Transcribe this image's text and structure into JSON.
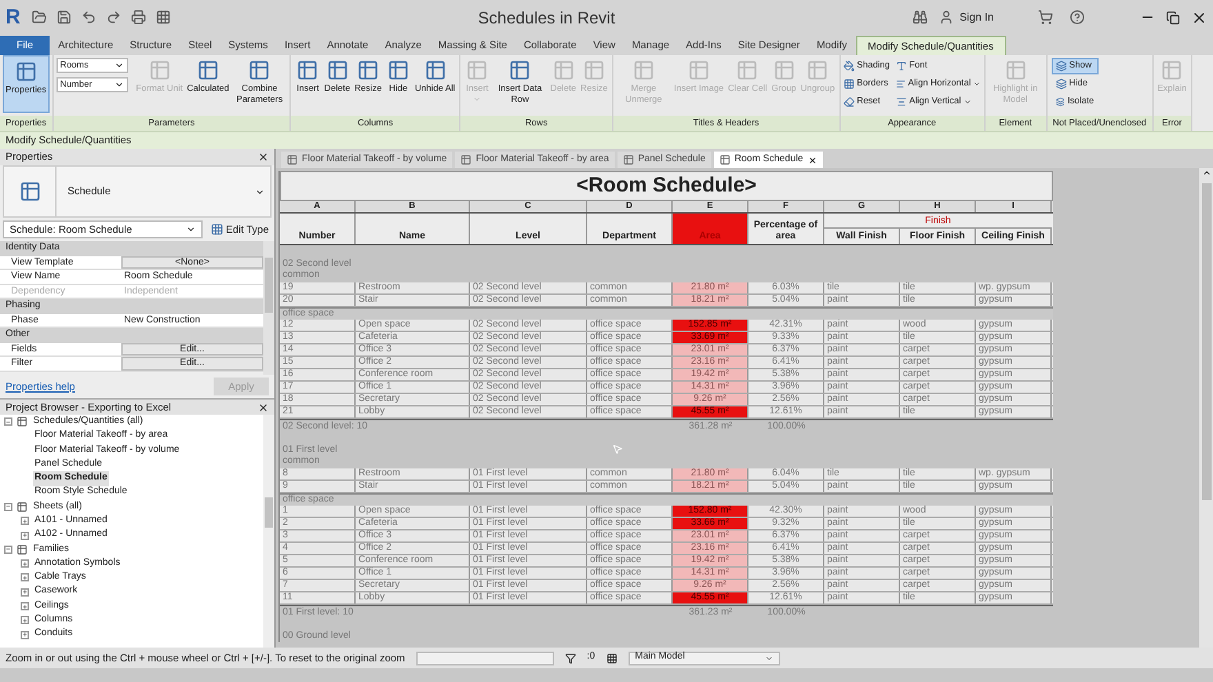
{
  "app_logo": "R",
  "window": {
    "title": "Schedules in Revit",
    "sign_in": "Sign In"
  },
  "ribbon_tabs": [
    {
      "label": "File",
      "kind": "file",
      "selected": false
    },
    {
      "label": "Architecture",
      "kind": "tab",
      "selected": false
    },
    {
      "label": "Structure",
      "kind": "tab",
      "selected": false
    },
    {
      "label": "Steel",
      "kind": "tab",
      "selected": false
    },
    {
      "label": "Systems",
      "kind": "tab",
      "selected": false
    },
    {
      "label": "Insert",
      "kind": "tab",
      "selected": false
    },
    {
      "label": "Annotate",
      "kind": "tab",
      "selected": false
    },
    {
      "label": "Analyze",
      "kind": "tab",
      "selected": false
    },
    {
      "label": "Massing & Site",
      "kind": "tab",
      "selected": false
    },
    {
      "label": "Collaborate",
      "kind": "tab",
      "selected": false
    },
    {
      "label": "View",
      "kind": "tab",
      "selected": false
    },
    {
      "label": "Manage",
      "kind": "tab",
      "selected": false
    },
    {
      "label": "Add-Ins",
      "kind": "tab",
      "selected": false
    },
    {
      "label": "Site Designer",
      "kind": "tab",
      "selected": false
    },
    {
      "label": "Modify",
      "kind": "tab",
      "selected": false
    },
    {
      "label": "Modify Schedule/Quantities",
      "kind": "tab",
      "selected": true
    }
  ],
  "ribbon_panels": [
    {
      "label": "Properties",
      "items": [
        {
          "kind": "large",
          "label": "Properties",
          "disabled": false,
          "active": true
        }
      ]
    },
    {
      "label": "Parameters",
      "items": [
        {
          "kind": "dropdowns",
          "values": [
            "Rooms",
            "Number"
          ]
        },
        {
          "kind": "large",
          "label": "Format Unit",
          "disabled": true
        },
        {
          "kind": "large",
          "label": "Calculated",
          "disabled": false
        },
        {
          "kind": "large",
          "label": "Combine Parameters",
          "disabled": false
        }
      ]
    },
    {
      "label": "Columns",
      "items": [
        {
          "kind": "large",
          "label": "Insert",
          "disabled": false
        },
        {
          "kind": "large",
          "label": "Delete",
          "disabled": false
        },
        {
          "kind": "large",
          "label": "Resize",
          "disabled": false
        },
        {
          "kind": "large",
          "label": "Hide",
          "disabled": false
        },
        {
          "kind": "large",
          "label": "Unhide All",
          "disabled": false
        }
      ]
    },
    {
      "label": "Rows",
      "items": [
        {
          "kind": "large",
          "label": "Insert",
          "disabled": true,
          "dropdown": true
        },
        {
          "kind": "large",
          "label": "Insert Data Row",
          "disabled": false
        },
        {
          "kind": "large",
          "label": "Delete",
          "disabled": true
        },
        {
          "kind": "large",
          "label": "Resize",
          "disabled": true
        }
      ]
    },
    {
      "label": "Titles & Headers",
      "items": [
        {
          "kind": "large",
          "label": "Merge Unmerge",
          "disabled": true
        },
        {
          "kind": "large",
          "label": "Insert Image",
          "disabled": true
        },
        {
          "kind": "large",
          "label": "Clear Cell",
          "disabled": true
        },
        {
          "kind": "large",
          "label": "Group",
          "disabled": true
        },
        {
          "kind": "large",
          "label": "Ungroup",
          "disabled": true
        }
      ]
    },
    {
      "label": "Appearance",
      "items": [
        {
          "kind": "smallgrid",
          "buttons": [
            {
              "label": "Shading",
              "dropdown": false
            },
            {
              "label": "Font",
              "dropdown": false
            },
            {
              "label": "Borders",
              "dropdown": false
            },
            {
              "label": "Align Horizontal",
              "dropdown": true
            },
            {
              "label": "Reset",
              "dropdown": false
            },
            {
              "label": "Align Vertical",
              "dropdown": true
            }
          ]
        }
      ]
    },
    {
      "label": "Element",
      "items": [
        {
          "kind": "large",
          "label": "Highlight in Model",
          "disabled": true
        }
      ]
    },
    {
      "label": "Not Placed/Unenclosed",
      "items": [
        {
          "kind": "smallstack",
          "buttons": [
            {
              "label": "Show",
              "selected": true
            },
            {
              "label": "Hide",
              "selected": false
            },
            {
              "label": "Isolate",
              "selected": false
            }
          ]
        }
      ]
    },
    {
      "label": "Error",
      "items": [
        {
          "kind": "large",
          "label": "Explain",
          "disabled": true
        }
      ]
    }
  ],
  "context_bar": "Modify Schedule/Quantities",
  "properties": {
    "title": "Properties",
    "type_name": "Schedule",
    "selector": "Schedule: Room Schedule",
    "edit_type": "Edit Type",
    "rows": [
      {
        "kind": "category",
        "label": "Identity Data"
      },
      {
        "kind": "button",
        "label": "View Template",
        "value": "<None>",
        "disabled": false
      },
      {
        "kind": "text",
        "label": "View Name",
        "value": "Room Schedule",
        "disabled": false
      },
      {
        "kind": "text",
        "label": "Dependency",
        "value": "Independent",
        "disabled": true
      },
      {
        "kind": "category",
        "label": "Phasing"
      },
      {
        "kind": "text",
        "label": "Phase",
        "value": "New Construction",
        "disabled": false
      },
      {
        "kind": "category",
        "label": "Other"
      },
      {
        "kind": "button",
        "label": "Fields",
        "value": "Edit...",
        "disabled": false
      },
      {
        "kind": "button",
        "label": "Filter",
        "value": "Edit...",
        "disabled": false
      }
    ],
    "help_link": "Properties help",
    "apply": "Apply",
    "apply_disabled": true
  },
  "project_browser": {
    "title": "Project Browser - Exporting to Excel",
    "tree": [
      {
        "label": "Schedules/Quantities (all)",
        "expanded": true,
        "selected": false,
        "children": [
          {
            "label": "Floor Material Takeoff - by area",
            "selected": false
          },
          {
            "label": "Floor Material Takeoff - by volume",
            "selected": false
          },
          {
            "label": "Panel Schedule",
            "selected": false
          },
          {
            "label": "Room Schedule",
            "selected": true
          },
          {
            "label": "Room Style Schedule",
            "selected": false
          }
        ]
      },
      {
        "label": "Sheets (all)",
        "expanded": true,
        "selected": false,
        "children": [
          {
            "label": "A101 - Unnamed",
            "expanded": false,
            "selected": false
          },
          {
            "label": "A102 - Unnamed",
            "expanded": false,
            "selected": false
          }
        ]
      },
      {
        "label": "Families",
        "expanded": true,
        "selected": false,
        "children": [
          {
            "label": "Annotation Symbols",
            "expanded": false,
            "selected": false
          },
          {
            "label": "Cable Trays",
            "expanded": false,
            "selected": false
          },
          {
            "label": "Casework",
            "expanded": false,
            "selected": false
          },
          {
            "label": "Ceilings",
            "expanded": false,
            "selected": false
          },
          {
            "label": "Columns",
            "expanded": false,
            "selected": false
          },
          {
            "label": "Conduits",
            "expanded": false,
            "selected": false
          }
        ]
      }
    ]
  },
  "document_tabs": [
    {
      "label": "Floor Material Takeoff - by volume",
      "selected": false
    },
    {
      "label": "Floor Material Takeoff - by area",
      "selected": false
    },
    {
      "label": "Panel Schedule",
      "selected": false
    },
    {
      "label": "Room Schedule",
      "selected": true
    }
  ],
  "schedule": {
    "title": "<Room Schedule>",
    "column_letters": [
      "A",
      "B",
      "C",
      "D",
      "E",
      "F",
      "G",
      "H",
      "I"
    ],
    "headers": [
      {
        "label": "Number",
        "highlighted": false
      },
      {
        "label": "Name",
        "highlighted": false
      },
      {
        "label": "Level",
        "highlighted": false
      },
      {
        "label": "Department",
        "highlighted": false
      },
      {
        "label": "Area",
        "highlighted": true
      },
      {
        "label": "Percentage of area",
        "highlighted": false
      },
      {
        "label": "Wall Finish",
        "highlighted": false
      },
      {
        "label": "Floor Finish",
        "highlighted": false
      },
      {
        "label": "Ceiling Finish",
        "highlighted": false
      }
    ],
    "header_group": "Finish",
    "sections": [
      {
        "heading": "02 Second level",
        "groups": [
          {
            "department": "common",
            "rows": [
              {
                "number": "19",
                "name": "Restroom",
                "level": "02 Second level",
                "department": "common",
                "area": "21.80 m²",
                "highlighted": false,
                "percentage": "6.03%",
                "wall_finish": "tile",
                "floor_finish": "tile",
                "ceiling_finish": "wp. gypsum"
              },
              {
                "number": "20",
                "name": "Stair",
                "level": "02 Second level",
                "department": "common",
                "area": "18.21 m²",
                "highlighted": false,
                "percentage": "5.04%",
                "wall_finish": "paint",
                "floor_finish": "tile",
                "ceiling_finish": "gypsum"
              }
            ]
          },
          {
            "department": "office space",
            "rows": [
              {
                "number": "12",
                "name": "Open space",
                "level": "02 Second level",
                "department": "office space",
                "area": "152.85 m²",
                "highlighted": true,
                "percentage": "42.31%",
                "wall_finish": "paint",
                "floor_finish": "wood",
                "ceiling_finish": "gypsum"
              },
              {
                "number": "13",
                "name": "Cafeteria",
                "level": "02 Second level",
                "department": "office space",
                "area": "33.69 m²",
                "highlighted": true,
                "percentage": "9.33%",
                "wall_finish": "paint",
                "floor_finish": "tile",
                "ceiling_finish": "gypsum"
              },
              {
                "number": "14",
                "name": "Office 3",
                "level": "02 Second level",
                "department": "office space",
                "area": "23.01 m²",
                "highlighted": false,
                "percentage": "6.37%",
                "wall_finish": "paint",
                "floor_finish": "carpet",
                "ceiling_finish": "gypsum"
              },
              {
                "number": "15",
                "name": "Office 2",
                "level": "02 Second level",
                "department": "office space",
                "area": "23.16 m²",
                "highlighted": false,
                "percentage": "6.41%",
                "wall_finish": "paint",
                "floor_finish": "carpet",
                "ceiling_finish": "gypsum"
              },
              {
                "number": "16",
                "name": "Conference room",
                "level": "02 Second level",
                "department": "office space",
                "area": "19.42 m²",
                "highlighted": false,
                "percentage": "5.38%",
                "wall_finish": "paint",
                "floor_finish": "carpet",
                "ceiling_finish": "gypsum"
              },
              {
                "number": "17",
                "name": "Office 1",
                "level": "02 Second level",
                "department": "office space",
                "area": "14.31 m²",
                "highlighted": false,
                "percentage": "3.96%",
                "wall_finish": "paint",
                "floor_finish": "carpet",
                "ceiling_finish": "gypsum"
              },
              {
                "number": "18",
                "name": "Secretary",
                "level": "02 Second level",
                "department": "office space",
                "area": "9.26 m²",
                "highlighted": false,
                "percentage": "2.56%",
                "wall_finish": "paint",
                "floor_finish": "carpet",
                "ceiling_finish": "gypsum"
              },
              {
                "number": "21",
                "name": "Lobby",
                "level": "02 Second level",
                "department": "office space",
                "area": "45.55 m²",
                "highlighted": true,
                "percentage": "12.61%",
                "wall_finish": "paint",
                "floor_finish": "tile",
                "ceiling_finish": "gypsum"
              }
            ]
          }
        ],
        "footer": {
          "label": "02 Second level: 10",
          "area": "361.28 m²",
          "percentage": "100.00%"
        }
      },
      {
        "heading": "01 First level",
        "groups": [
          {
            "department": "common",
            "rows": [
              {
                "number": "8",
                "name": "Restroom",
                "level": "01 First level",
                "department": "common",
                "area": "21.80 m²",
                "highlighted": false,
                "percentage": "6.04%",
                "wall_finish": "tile",
                "floor_finish": "tile",
                "ceiling_finish": "wp. gypsum"
              },
              {
                "number": "9",
                "name": "Stair",
                "level": "01 First level",
                "department": "common",
                "area": "18.21 m²",
                "highlighted": false,
                "percentage": "5.04%",
                "wall_finish": "paint",
                "floor_finish": "tile",
                "ceiling_finish": "gypsum"
              }
            ]
          },
          {
            "department": "office space",
            "rows": [
              {
                "number": "1",
                "name": "Open space",
                "level": "01 First level",
                "department": "office space",
                "area": "152.80 m²",
                "highlighted": true,
                "percentage": "42.30%",
                "wall_finish": "paint",
                "floor_finish": "wood",
                "ceiling_finish": "gypsum"
              },
              {
                "number": "2",
                "name": "Cafeteria",
                "level": "01 First level",
                "department": "office space",
                "area": "33.66 m²",
                "highlighted": true,
                "percentage": "9.32%",
                "wall_finish": "paint",
                "floor_finish": "tile",
                "ceiling_finish": "gypsum"
              },
              {
                "number": "3",
                "name": "Office 3",
                "level": "01 First level",
                "department": "office space",
                "area": "23.01 m²",
                "highlighted": false,
                "percentage": "6.37%",
                "wall_finish": "paint",
                "floor_finish": "carpet",
                "ceiling_finish": "gypsum"
              },
              {
                "number": "4",
                "name": "Office 2",
                "level": "01 First level",
                "department": "office space",
                "area": "23.16 m²",
                "highlighted": false,
                "percentage": "6.41%",
                "wall_finish": "paint",
                "floor_finish": "carpet",
                "ceiling_finish": "gypsum"
              },
              {
                "number": "5",
                "name": "Conference room",
                "level": "01 First level",
                "department": "office space",
                "area": "19.42 m²",
                "highlighted": false,
                "percentage": "5.38%",
                "wall_finish": "paint",
                "floor_finish": "carpet",
                "ceiling_finish": "gypsum"
              },
              {
                "number": "6",
                "name": "Office 1",
                "level": "01 First level",
                "department": "office space",
                "area": "14.31 m²",
                "highlighted": false,
                "percentage": "3.96%",
                "wall_finish": "paint",
                "floor_finish": "carpet",
                "ceiling_finish": "gypsum"
              },
              {
                "number": "7",
                "name": "Secretary",
                "level": "01 First level",
                "department": "office space",
                "area": "9.26 m²",
                "highlighted": false,
                "percentage": "2.56%",
                "wall_finish": "paint",
                "floor_finish": "carpet",
                "ceiling_finish": "gypsum"
              },
              {
                "number": "11",
                "name": "Lobby",
                "level": "01 First level",
                "department": "office space",
                "area": "45.55 m²",
                "highlighted": true,
                "percentage": "12.61%",
                "wall_finish": "paint",
                "floor_finish": "tile",
                "ceiling_finish": "gypsum"
              }
            ]
          }
        ],
        "footer": {
          "label": "01 First level: 10",
          "area": "361.23 m²",
          "percentage": "100.00%"
        }
      },
      {
        "heading": "00 Ground level"
      }
    ]
  },
  "status_bar": {
    "message": "Zoom in or out using the Ctrl + mouse wheel or Ctrl + [+/-]. To reset to the original zoom",
    "selection_count": ":0",
    "model": "Main Model"
  }
}
